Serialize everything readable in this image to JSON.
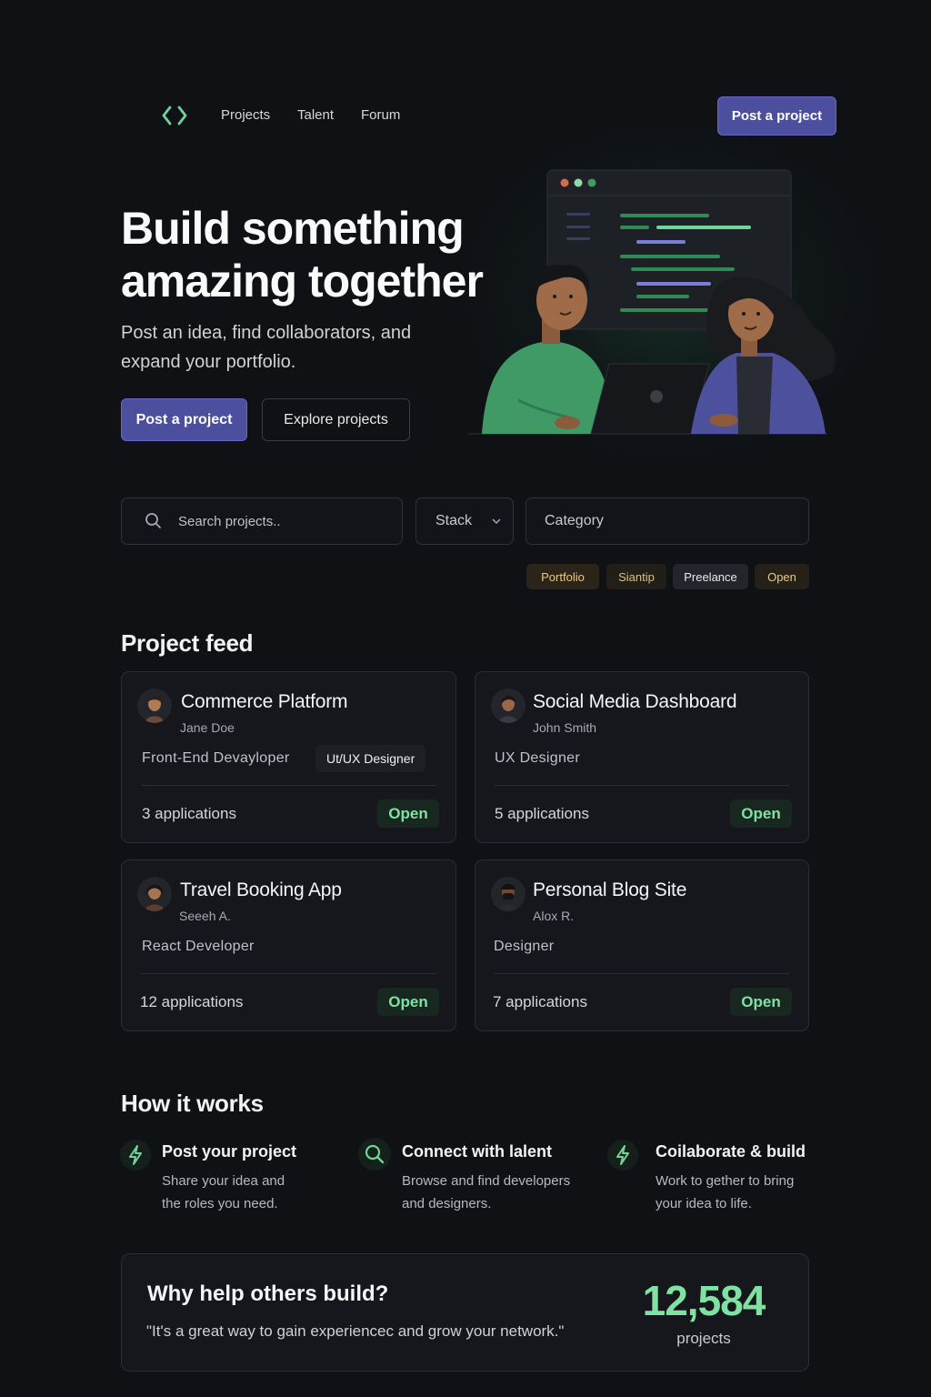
{
  "nav": {
    "logo_icon": "code-brackets-icon",
    "links": [
      "Projects",
      "Talent",
      "Forum"
    ],
    "cta": "Post a project"
  },
  "hero": {
    "title_line1": "Build something",
    "title_line2": "amazing together",
    "subtitle_line1": "Post an idea, find collaborators,  and",
    "subtitle_line2": "expand your portfolio.",
    "primary_button": "Post a project",
    "secondary_button": "Explore projects"
  },
  "filters": {
    "search_placeholder": "Search projects..",
    "stack_label": "Stack",
    "category_label": "Category",
    "tags": [
      "Portfolio",
      "Siantip",
      "Preelance",
      "Open"
    ]
  },
  "feed": {
    "title": "Project feed",
    "projects": [
      {
        "title": "Commerce Platform",
        "owner": "Jane Doe",
        "role": "Front-End Devayloper",
        "chip": "Ut/UX Designer",
        "applications": "3 applications",
        "status": "Open"
      },
      {
        "title": "Social Media Dashboard",
        "owner": "John Smith",
        "role": "UX Designer",
        "applications": "5 applications",
        "status": "Open"
      },
      {
        "title": "Travel Booking App",
        "owner": "Seeeh A.",
        "role": "React Developer",
        "applications": "12 applications",
        "status": "Open"
      },
      {
        "title": "Personal Blog Site",
        "owner": "Alox R.",
        "role": "Designer",
        "applications": "7 applications",
        "status": "Open"
      }
    ]
  },
  "how": {
    "title": "How it works",
    "steps": [
      {
        "icon": "lightning-icon",
        "title": "Post your project",
        "desc1": "Share your idea and",
        "desc2": "the roles you need."
      },
      {
        "icon": "search-icon",
        "title": "Connect with lalent",
        "desc1": "Browse and find developers",
        "desc2": "and designers."
      },
      {
        "icon": "lightning-icon",
        "title": "Coilaborate & build",
        "desc1": "Work to gether to bring",
        "desc2": "your idea to life."
      }
    ]
  },
  "why": {
    "title": "Why help others build?",
    "quote": "\"It's a great way to gain experiencec and grow your network.\"",
    "stat_value": "12,584",
    "stat_label": "projects"
  },
  "colors": {
    "background": "#0f1115",
    "accent_purple": "#4c4f9e",
    "accent_green": "#7ee3a2"
  }
}
